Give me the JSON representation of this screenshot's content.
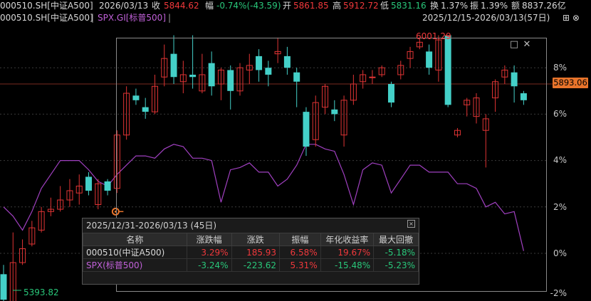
{
  "header": {
    "code": "000510.SH[中证A500]",
    "date": "2026/03/13",
    "close_label": "收",
    "close": "5844.62",
    "amp_label": "幅",
    "amp": "-0.74%(-43.59)",
    "open_label": "开",
    "open": "5861.85",
    "high_label": "高",
    "high": "5912.72",
    "low_label": "低",
    "low": "5831.16",
    "turnover_label": "换",
    "turnover": "1.37%",
    "swing_label": "振",
    "swing": "1.39%",
    "volume_label": "额",
    "volume": "8837.26亿"
  },
  "header2": {
    "legend_code": "000510.SH[中证A500]",
    "sep": "|",
    "compare": "SPX.GI[标普500]",
    "sep2": "|",
    "range": "2025/12/15-2026/03/13(57日)",
    "right_icons": "⊞ ⊗"
  },
  "axis": {
    "labels": [
      "8%",
      "6%",
      "4%",
      "2%",
      "0%",
      "-2%"
    ],
    "current_price": "5893.06"
  },
  "markers": {
    "high_marker": "6001.29",
    "low_marker": "5393.82"
  },
  "zoom_icons": [
    "□",
    "✕"
  ],
  "tooltip": {
    "title": "2025/12/31-2026/03/13 (45日)",
    "close_icon": "×",
    "headers": [
      "名称",
      "涨跌幅",
      "涨跌",
      "振幅",
      "年化收益率",
      "最大回撤"
    ],
    "rows": [
      {
        "name": "000510(中证A500)",
        "chg_pct": "3.29%",
        "chg": "185.93",
        "amp": "6.58%",
        "annual": "19.67%",
        "maxdd": "-5.18%"
      },
      {
        "name": "SPX(标普500)",
        "chg_pct": "-3.24%",
        "chg": "-223.62",
        "amp": "5.31%",
        "annual": "-15.48%",
        "maxdd": "-5.23%"
      }
    ]
  },
  "chart_data": {
    "type": "candlestick",
    "y_axis_pct": {
      "min": -2,
      "max": 9
    },
    "candles": [
      {
        "o": -0.9,
        "c": -2.0,
        "h": -0.5,
        "l": -2.4
      },
      {
        "o": -2.1,
        "c": -0.4,
        "h": 0.9,
        "l": -2.2
      },
      {
        "o": -0.4,
        "c": 0.2,
        "h": 0.6,
        "l": -0.5
      },
      {
        "o": 0.4,
        "c": 1.1,
        "h": 1.4,
        "l": 0.3
      },
      {
        "o": 1.0,
        "c": 1.8,
        "h": 2.0,
        "l": 0.9
      },
      {
        "o": 1.8,
        "c": 1.9,
        "h": 2.4,
        "l": 1.6
      },
      {
        "o": 1.9,
        "c": 2.3,
        "h": 2.9,
        "l": 1.8
      },
      {
        "o": 2.3,
        "c": 2.7,
        "h": 3.2,
        "l": 2.0
      },
      {
        "o": 2.6,
        "c": 2.9,
        "h": 3.4,
        "l": 2.1
      },
      {
        "o": 3.3,
        "c": 2.7,
        "h": 3.5,
        "l": 2.5
      },
      {
        "o": 2.1,
        "c": 3.0,
        "h": 3.2,
        "l": 1.9
      },
      {
        "o": 3.1,
        "c": 2.7,
        "h": 3.2,
        "l": 2.5
      },
      {
        "o": 2.8,
        "c": 5.1,
        "h": 5.3,
        "l": 2.6
      },
      {
        "o": 5.1,
        "c": 6.9,
        "h": 7.2,
        "l": 4.9
      },
      {
        "o": 6.8,
        "c": 6.6,
        "h": 7.1,
        "l": 6.4
      },
      {
        "o": 6.3,
        "c": 6.1,
        "h": 6.7,
        "l": 5.8
      },
      {
        "o": 6.1,
        "c": 7.2,
        "h": 7.7,
        "l": 6.0
      },
      {
        "o": 7.6,
        "c": 8.4,
        "h": 9.0,
        "l": 7.2
      },
      {
        "o": 8.6,
        "c": 7.6,
        "h": 9.4,
        "l": 7.3
      },
      {
        "o": 7.4,
        "c": 7.7,
        "h": 8.3,
        "l": 6.9
      },
      {
        "o": 7.7,
        "c": 7.6,
        "h": 9.4,
        "l": 7.1
      },
      {
        "o": 7.0,
        "c": 7.7,
        "h": 8.6,
        "l": 6.9
      },
      {
        "o": 8.2,
        "c": 7.2,
        "h": 8.7,
        "l": 6.8
      },
      {
        "o": 7.3,
        "c": 7.9,
        "h": 8.0,
        "l": 6.6
      },
      {
        "o": 7.9,
        "c": 7.0,
        "h": 8.1,
        "l": 6.2
      },
      {
        "o": 7.0,
        "c": 8.0,
        "h": 8.2,
        "l": 6.8
      },
      {
        "o": 7.9,
        "c": 8.1,
        "h": 8.6,
        "l": 7.3
      },
      {
        "o": 8.5,
        "c": 7.9,
        "h": 8.8,
        "l": 7.4
      },
      {
        "o": 8.0,
        "c": 7.7,
        "h": 8.3,
        "l": 7.2
      },
      {
        "o": 8.6,
        "c": 8.7,
        "h": 9.3,
        "l": 8.2
      },
      {
        "o": 8.5,
        "c": 8.0,
        "h": 8.9,
        "l": 7.7
      },
      {
        "o": 7.8,
        "c": 7.4,
        "h": 8.0,
        "l": 6.3
      },
      {
        "o": 6.1,
        "c": 4.6,
        "h": 6.3,
        "l": 4.2
      },
      {
        "o": 4.9,
        "c": 6.5,
        "h": 6.8,
        "l": 4.6
      },
      {
        "o": 6.3,
        "c": 7.2,
        "h": 7.3,
        "l": 6.0
      },
      {
        "o": 6.2,
        "c": 6.0,
        "h": 6.6,
        "l": 5.7
      },
      {
        "o": 5.1,
        "c": 6.6,
        "h": 6.8,
        "l": 4.6
      },
      {
        "o": 6.6,
        "c": 7.3,
        "h": 7.7,
        "l": 6.4
      },
      {
        "o": 7.4,
        "c": 7.7,
        "h": 7.9,
        "l": 7.1
      },
      {
        "o": 7.6,
        "c": 7.6,
        "h": 7.9,
        "l": 7.3
      },
      {
        "o": 7.7,
        "c": 8.0,
        "h": 8.1,
        "l": 7.6
      },
      {
        "o": 7.3,
        "c": 6.5,
        "h": 7.4,
        "l": 6.3
      },
      {
        "o": 7.7,
        "c": 8.1,
        "h": 8.3,
        "l": 7.5
      },
      {
        "o": 8.4,
        "c": 8.7,
        "h": 8.9,
        "l": 8.0
      },
      {
        "o": 8.9,
        "c": 9.1,
        "h": 9.3,
        "l": 8.8
      },
      {
        "o": 8.7,
        "c": 8.0,
        "h": 9.0,
        "l": 7.7
      },
      {
        "o": 7.9,
        "c": 9.2,
        "h": 9.4,
        "l": 7.4
      },
      {
        "o": 9.4,
        "c": 6.4,
        "h": 9.4,
        "l": 6.3
      },
      {
        "o": 5.1,
        "c": 5.3,
        "h": 5.4,
        "l": 5.0
      },
      {
        "o": 6.4,
        "c": 6.6,
        "h": 6.7,
        "l": 5.9
      },
      {
        "o": 5.9,
        "c": 6.7,
        "h": 6.9,
        "l": 5.6
      },
      {
        "o": 5.3,
        "c": 5.8,
        "h": 6.0,
        "l": 3.7
      },
      {
        "o": 6.7,
        "c": 7.4,
        "h": 7.5,
        "l": 6.1
      },
      {
        "o": 7.6,
        "c": 7.9,
        "h": 8.1,
        "l": 7.3
      },
      {
        "o": 7.8,
        "c": 7.2,
        "h": 8.1,
        "l": 6.5
      },
      {
        "o": 6.9,
        "c": 6.6,
        "h": 7.0,
        "l": 6.4
      }
    ],
    "comparison_line": {
      "name": "SPX.GI[标普500]",
      "values": [
        2.0,
        1.6,
        1.0,
        1.8,
        2.8,
        3.4,
        4.0,
        4.0,
        4.0,
        3.6,
        3.1,
        2.9,
        3.4,
        3.8,
        4.2,
        4.2,
        4.1,
        4.5,
        4.7,
        4.6,
        4.1,
        4.1,
        4.0,
        2.2,
        3.6,
        3.7,
        3.9,
        3.5,
        3.5,
        2.9,
        3.2,
        3.8,
        4.7,
        4.7,
        4.5,
        4.4,
        3.4,
        2.1,
        3.6,
        3.9,
        3.8,
        2.6,
        3.2,
        3.8,
        3.8,
        3.5,
        3.5,
        3.5,
        3.0,
        3.0,
        2.8,
        2.0,
        2.2,
        1.7,
        1.8,
        0.1
      ]
    },
    "price_level_pct": 7.3
  }
}
